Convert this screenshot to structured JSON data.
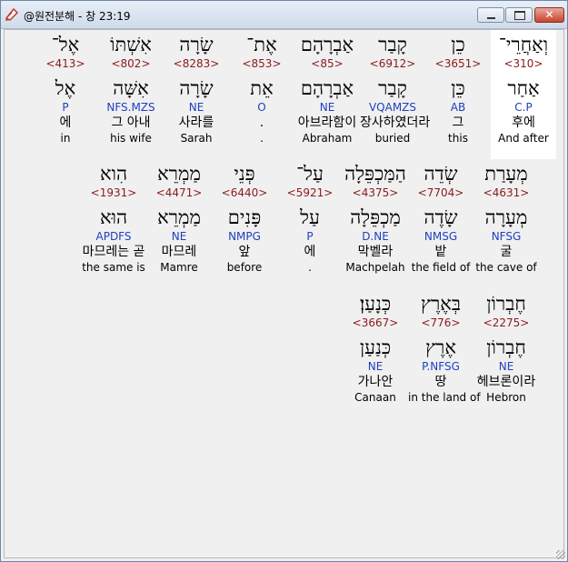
{
  "window": {
    "title": "@원전분해 - 창 23:19",
    "min_label": "",
    "max_label": "",
    "close_label": "✕"
  },
  "rows": [
    [
      {
        "heb": "וְאַחֲרֵי־",
        "strong": "<310>",
        "lex": "אַחַר",
        "morph": "C.P",
        "kor": "후에",
        "eng": "And after",
        "selected": true
      },
      {
        "heb": "כֵן",
        "strong": "<3651>",
        "lex": "כֵּן",
        "morph": "AB",
        "kor": "그",
        "eng": "this"
      },
      {
        "heb": "קָבַר",
        "strong": "<6912>",
        "lex": "קָבַר",
        "morph": "VQAMZS",
        "kor": "장사하였더라",
        "eng": "buried"
      },
      {
        "heb": "אַבְרָהָם",
        "strong": "<85>",
        "lex": "אַבְרָהָם",
        "morph": "NE",
        "kor": "아브라함이",
        "eng": "Abraham"
      },
      {
        "heb": "אֶת־",
        "strong": "<853>",
        "lex": "אֵת",
        "morph": "O",
        "kor": ".",
        "eng": "."
      },
      {
        "heb": "שָׂרָה",
        "strong": "<8283>",
        "lex": "שָׂרָה",
        "morph": "NE",
        "kor": "사라를",
        "eng": "Sarah"
      },
      {
        "heb": "אִשְׁתּוֹ",
        "strong": "<802>",
        "lex": "אִשָּׁה",
        "morph": "NFS.MZS",
        "kor": "그 아내",
        "eng": "his wife"
      },
      {
        "heb": "אֶל־",
        "strong": "<413>",
        "lex": "אֶל",
        "morph": "P",
        "kor": "에",
        "eng": "in"
      }
    ],
    [
      {
        "heb": "מְעָרַת",
        "strong": "<4631>",
        "lex": "מְעָרָה",
        "morph": "NFSG",
        "kor": "굴",
        "eng": "the cave of"
      },
      {
        "heb": "שְׂדֵה",
        "strong": "<7704>",
        "lex": "שָׂדֶה",
        "morph": "NMSG",
        "kor": "밭",
        "eng": "the field of"
      },
      {
        "heb": "הַמַּכְפֵּלָה",
        "strong": "<4375>",
        "lex": "מַכְפֵּלָה",
        "morph": "D.NE",
        "kor": "막벨라",
        "eng": "Machpelah"
      },
      {
        "heb": "עַל־",
        "strong": "<5921>",
        "lex": "עַל",
        "morph": "P",
        "kor": "에",
        "eng": "."
      },
      {
        "heb": "פְּנֵי",
        "strong": "<6440>",
        "lex": "פָּנִים",
        "morph": "NMPG",
        "kor": "앞",
        "eng": "before"
      },
      {
        "heb": "מַמְרֵא",
        "strong": "<4471>",
        "lex": "מַמְרֵא",
        "morph": "NE",
        "kor": "마므레",
        "eng": "Mamre"
      },
      {
        "heb": "הִוא",
        "strong": "<1931>",
        "lex": "הוּא",
        "morph": "APDFS",
        "kor": "마므레는 곧",
        "eng": "the same is"
      }
    ],
    [
      {
        "heb": "חֶבְרוֹן",
        "strong": "<2275>",
        "lex": "חֶבְרוֹן",
        "morph": "NE",
        "kor": "헤브론이라",
        "eng": "Hebron"
      },
      {
        "heb": "בְּאֶרֶץ",
        "strong": "<776>",
        "lex": "אֶרֶץ",
        "morph": "P.NFSG",
        "kor": "땅",
        "eng": "in the land of"
      },
      {
        "heb": "כְּנָעַן׃",
        "strong": "<3667>",
        "lex": "כְּנַעַן",
        "morph": "NE",
        "kor": "가나안",
        "eng": "Canaan"
      }
    ]
  ]
}
